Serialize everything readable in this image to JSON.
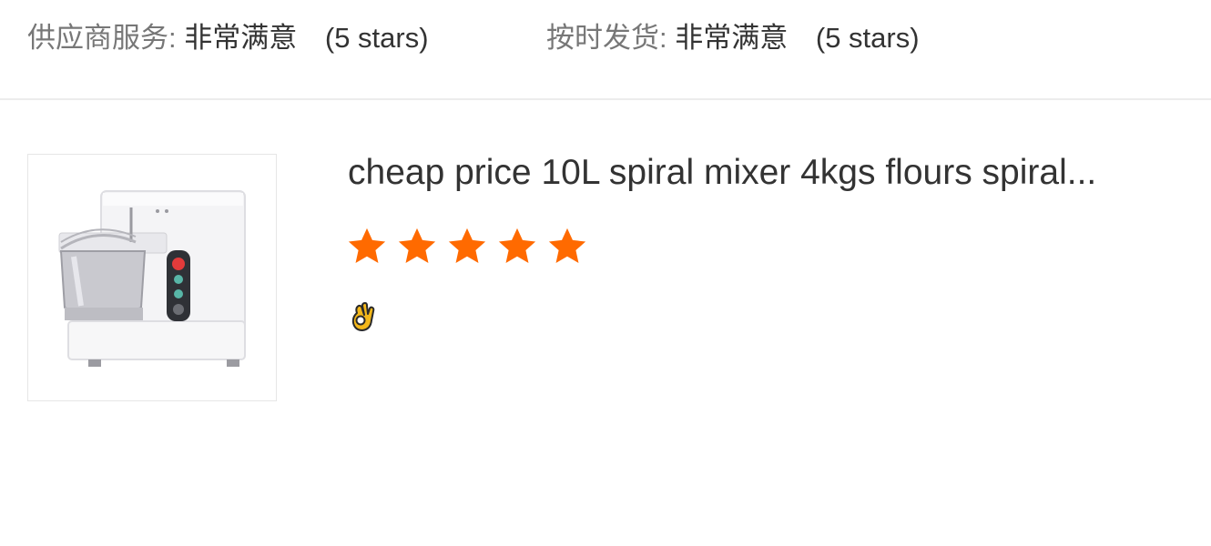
{
  "ratings": [
    {
      "label": "供应商服务:",
      "value": "非常满意",
      "stars_text": "(5 stars)"
    },
    {
      "label": "按时发货:",
      "value": "非常满意",
      "stars_text": "(5 stars)"
    }
  ],
  "review": {
    "product_title": "cheap price 10L spiral mixer 4kgs flours spiral...",
    "rating": 5,
    "rating_max": 5,
    "star_color": "#ff6a00",
    "comment_emoji_name": "ok-hand-emoji"
  }
}
